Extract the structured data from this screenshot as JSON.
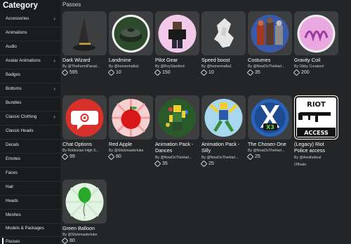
{
  "sidebar": {
    "title": "Category",
    "items": [
      {
        "label": "Accessories",
        "chevron": true
      },
      {
        "label": "Animations",
        "chevron": false
      },
      {
        "label": "Audio",
        "chevron": false
      },
      {
        "label": "Avatar Animations",
        "chevron": true
      },
      {
        "label": "Badges",
        "chevron": false
      },
      {
        "label": "Bottoms",
        "chevron": true
      },
      {
        "label": "Bundles",
        "chevron": false
      },
      {
        "label": "Classic Clothing",
        "chevron": true
      },
      {
        "label": "Classic Heads",
        "chevron": false
      },
      {
        "label": "Decals",
        "chevron": false
      },
      {
        "label": "Emotes",
        "chevron": false
      },
      {
        "label": "Faces",
        "chevron": false
      },
      {
        "label": "Hair",
        "chevron": false
      },
      {
        "label": "Heads",
        "chevron": false
      },
      {
        "label": "Meshes",
        "chevron": false
      },
      {
        "label": "Models & Packages",
        "chevron": false
      },
      {
        "label": "Passes",
        "chevron": false,
        "active": true
      }
    ]
  },
  "main": {
    "title": "Passes",
    "items": [
      {
        "name": "Dark Wizard",
        "creator": "By @TheFermiParad...",
        "price": "595",
        "icon": "wizard-hat-icon"
      },
      {
        "name": "Landmine",
        "creator": "By @homermafia1",
        "price": "10",
        "icon": "landmine-icon"
      },
      {
        "name": "Pilot Gear",
        "creator": "By @RoyStanford",
        "price": "150",
        "icon": "pilot-avatar-icon"
      },
      {
        "name": "Speed boost",
        "creator": "By @homermafia1",
        "price": "10",
        "icon": "speed-avatar-icon"
      },
      {
        "name": "Costumes",
        "creator": "By @NowDoTheHarl...",
        "price": "35",
        "icon": "costumes-icon"
      },
      {
        "name": "Gravity Coil",
        "creator": "By Obby Creators!",
        "price": "200",
        "icon": "gravity-coil-icon"
      },
      {
        "name": "Chat Options",
        "creator": "By Robloxian High S...",
        "price": "99",
        "icon": "chat-bubble-icon"
      },
      {
        "name": "Red Apple",
        "creator": "By @Stickmasterluke",
        "price": "80",
        "icon": "apple-icon"
      },
      {
        "name": "Animation Pack - Dances",
        "creator": "By @NowDoTheHarl...",
        "price": "35",
        "icon": "dance-avatar-icon"
      },
      {
        "name": "Animation Pack - Silly",
        "creator": "By @NowDoTheHarl...",
        "price": "25",
        "icon": "silly-avatar-icon"
      },
      {
        "name": "The Chosen One",
        "creator": "By @NowDoTheHarl...",
        "price": "25",
        "icon": "x3-badge-icon"
      },
      {
        "name": "(Legacy) Riot Police access",
        "creator": "By @Aesthetical",
        "price": "",
        "offsale": "Offsale",
        "icon": "riot-access-icon"
      },
      {
        "name": "Green Balloon",
        "creator": "By @Stickmasterluke",
        "price": "80",
        "icon": "green-balloon-icon"
      }
    ],
    "riot_text_top": "RIOT",
    "riot_text_bottom": "ACCESS",
    "x3_text": "X3"
  }
}
